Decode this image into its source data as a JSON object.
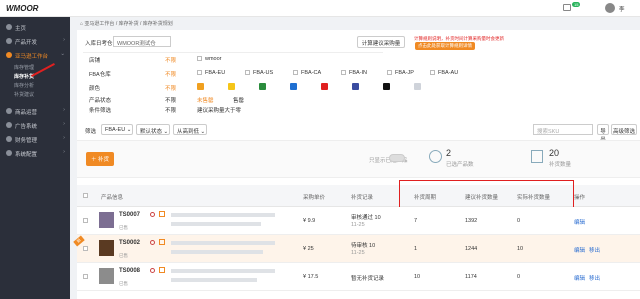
{
  "brand": {
    "logo_text": "WMOOR",
    "accent": "#f08a24",
    "sidebar_bg": "#2b2f3a"
  },
  "header": {
    "breadcrumb": [
      "首页",
      "亚马逊工作台",
      "库存补货",
      "库存补货规划"
    ],
    "badge_count": "15",
    "user_short": "李"
  },
  "sidebar": {
    "items": [
      {
        "label": "主页",
        "icon": "home-icon"
      },
      {
        "label": "产品开发",
        "icon": "product-icon"
      },
      {
        "label": "亚马逊工作台",
        "icon": "amazon-icon"
      },
      {
        "label": "商品运营",
        "icon": "goods-icon"
      },
      {
        "label": "广告系统",
        "icon": "ad-icon"
      },
      {
        "label": "财务管理",
        "icon": "finance-icon"
      },
      {
        "label": "系统配置",
        "icon": "settings-icon"
      }
    ],
    "subitems": [
      "库存管理",
      "库存补货",
      "库存分析",
      "补货建议"
    ]
  },
  "filters": {
    "entry_label": "入库日考仓",
    "entry_placeholder": "WMOOR测试仓",
    "calc_button": "计算建议采购量",
    "notice_line1": "计算规则说明，补货时间计算采购量时会更新",
    "notice_line2": "点击此处获取计算规则详情",
    "rows": [
      {
        "label": "店铺",
        "all": "不限",
        "options": [
          "wmoor"
        ]
      },
      {
        "label": "FBA仓库",
        "all": "不限",
        "options": [
          "FBA-EU",
          "FBA-US",
          "FBA-CA",
          "FBA-IN",
          "FBA-JP",
          "FBA-AU"
        ]
      },
      {
        "label": "颜色",
        "all": "不限",
        "options": []
      },
      {
        "label": "产品状态",
        "all": "不限",
        "options": [
          "未售罄",
          "售罄"
        ]
      },
      {
        "label": "条件筛选",
        "all": "不限",
        "options": [
          "建议采购量大于零"
        ]
      }
    ],
    "colors": [
      "#f0a020",
      "#f5c518",
      "#2a8c3c",
      "#1f6fd1",
      "#e02020",
      "#3a4ca0",
      "#111111",
      "#cfd3da"
    ]
  },
  "toolbar": {
    "filter_label": "筛选",
    "warehouse": "FBA-EU",
    "status": "默认状态",
    "sort": "从高到低",
    "search_placeholder": "搜索SKU",
    "export_label": "导出",
    "advanced_label": "高级筛选"
  },
  "summary": {
    "add_button": "补货",
    "toggle_label": "只显示已选产品",
    "products_value": "2",
    "products_label": "已选产品数",
    "qty_value": "20",
    "qty_label": "补货数量"
  },
  "table": {
    "headers": [
      "产品信息",
      "采购单价",
      "补货记录",
      "补货周期",
      "建议补货数量",
      "实际补货数量",
      "操作"
    ],
    "rows": [
      {
        "sku": "TS0007",
        "price": "¥ 9.9",
        "record_line1": "审核通过 10",
        "record_line2": "11-25",
        "cycle": "7",
        "suggest": "1392",
        "actual": "0",
        "action1": "编辑",
        "action2": "",
        "badge": "",
        "sub_label": "已售"
      },
      {
        "sku": "TS0002",
        "price": "¥ 25",
        "record_line1": "待审核 10",
        "record_line2": "11-25",
        "cycle": "1",
        "suggest": "1244",
        "actual": "10",
        "action1": "编辑",
        "action2": "移出",
        "badge": "新",
        "sub_label": "已售"
      },
      {
        "sku": "TS0008",
        "price": "¥ 17.5",
        "record_line1": "暂无补货记录",
        "record_line2": "",
        "cycle": "10",
        "suggest": "1174",
        "actual": "0",
        "action1": "编辑",
        "action2": "移出",
        "badge": "",
        "sub_label": "已售"
      }
    ]
  }
}
